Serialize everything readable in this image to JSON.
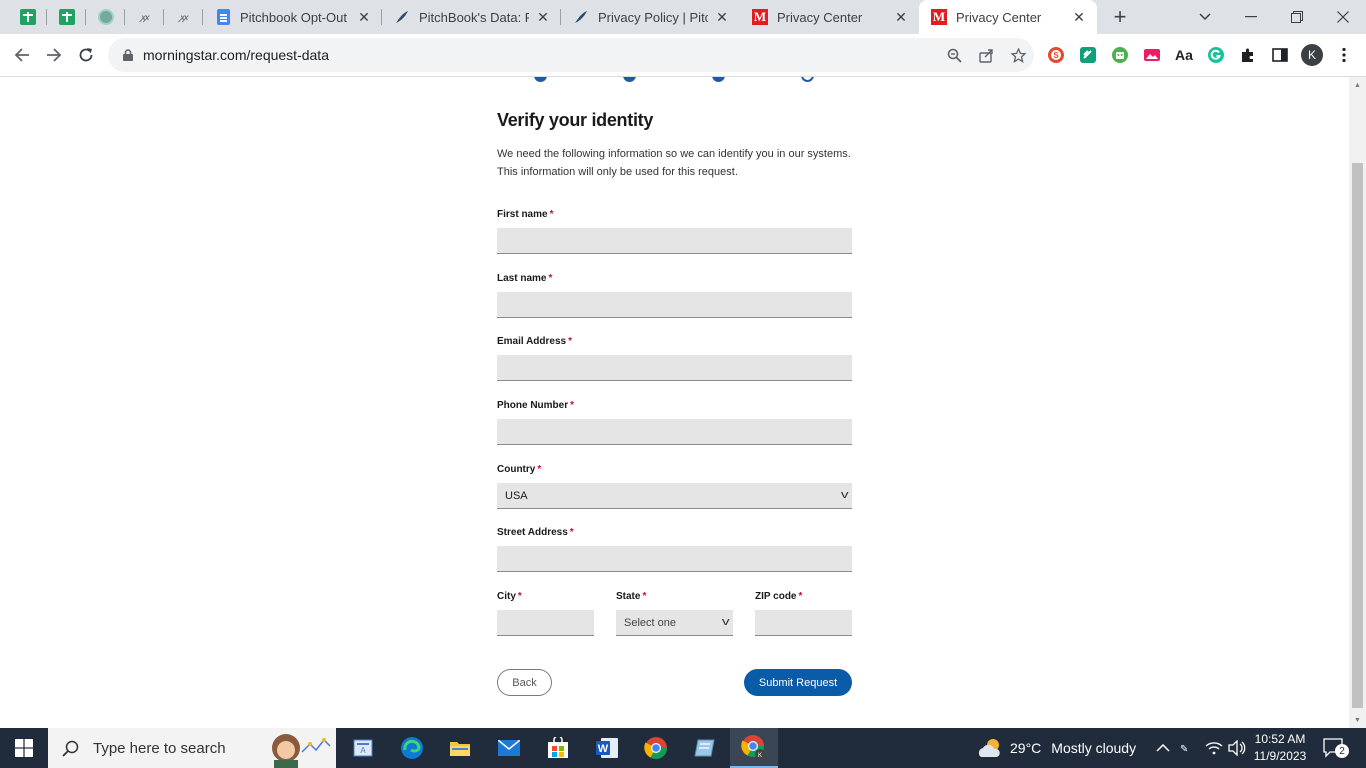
{
  "browser": {
    "tabs": [
      {
        "title": "",
        "icon": "sheets-icon",
        "pinned": true
      },
      {
        "title": "",
        "icon": "sheets-icon",
        "pinned": true
      },
      {
        "title": "",
        "icon": "chatgpt-icon",
        "pinned": true
      },
      {
        "title": "",
        "icon": "extension-mark-icon",
        "pinned": true
      },
      {
        "title": "",
        "icon": "extension-mark-icon",
        "pinned": true
      },
      {
        "title": "Pitchbook Opt-Out -",
        "icon": "docs-icon"
      },
      {
        "title": "PitchBook's Data: Pri",
        "icon": "pitchbook-icon"
      },
      {
        "title": "Privacy Policy | PitchB",
        "icon": "pitchbook-icon"
      },
      {
        "title": "Privacy Center",
        "icon": "morningstar-icon"
      },
      {
        "title": "Privacy Center",
        "icon": "morningstar-icon",
        "active": true
      }
    ],
    "new_tab_symbol": "+",
    "url": "morningstar.com/request-data",
    "profile_initial": "K",
    "extensions": [
      "shield-extension-icon",
      "edit-extension-icon",
      "robot-extension-icon",
      "picture-extension-icon",
      "font-extension-icon",
      "grammarly-icon",
      "puzzle-extensions-icon",
      "side-panel-icon"
    ],
    "font_ext_label": "Aa"
  },
  "form": {
    "heading": "Verify your identity",
    "intro_line1": "We need the following information so we can identify you in our systems.",
    "intro_line2": "This information will only be used for this request.",
    "required_mark": "*",
    "labels": {
      "first_name": "First name",
      "last_name": "Last name",
      "email": "Email Address",
      "phone": "Phone Number",
      "country": "Country",
      "street": "Street Address",
      "city": "City",
      "state": "State",
      "zip": "ZIP code"
    },
    "values": {
      "first_name": "",
      "last_name": "",
      "email": "",
      "phone": "",
      "country": "USA",
      "street": "",
      "city": "",
      "state": "Select one",
      "zip": ""
    },
    "back_label": "Back",
    "submit_label": "Submit Request"
  },
  "colors": {
    "accent": "#0a5ba8",
    "required": "#c8102e",
    "field_bg": "#e5e5e5"
  },
  "taskbar": {
    "search_placeholder": "Type here to search",
    "weather_temp": "29°C",
    "weather_text": "Mostly cloudy",
    "time": "10:52 AM",
    "date": "11/9/2023",
    "notification_count": "2",
    "apps": [
      "file-explorer-icon",
      "edge-icon",
      "folder-icon",
      "mail-icon",
      "store-icon",
      "word-icon",
      "chrome-icon",
      "notes-icon",
      "chrome-profile-icon"
    ]
  }
}
